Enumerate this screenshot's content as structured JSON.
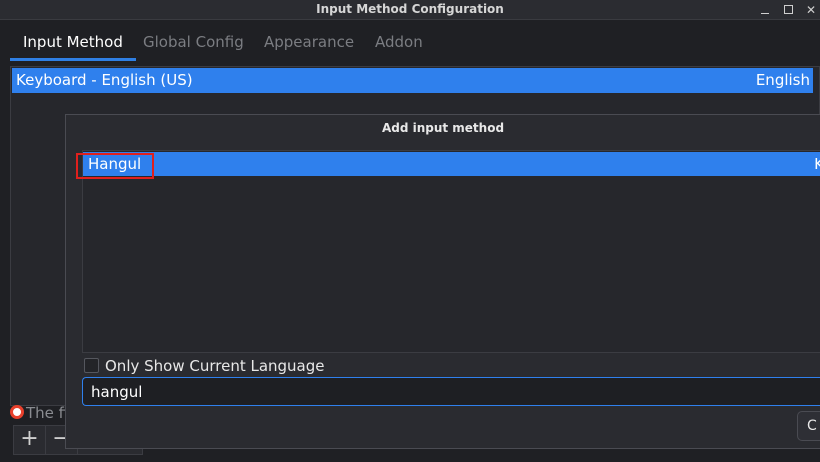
{
  "window": {
    "title": "Input Method Configuration",
    "min_icon": "minimize-icon",
    "max_icon": "maximize-icon",
    "close_icon": "close-icon",
    "close_glyph": "✕"
  },
  "tabs": [
    {
      "label": "Input Method",
      "active": true
    },
    {
      "label": "Global Config",
      "active": false
    },
    {
      "label": "Appearance",
      "active": false
    },
    {
      "label": "Addon",
      "active": false
    }
  ],
  "current_methods": [
    {
      "name": "Keyboard - English (US)",
      "language": "English"
    }
  ],
  "status": {
    "icon": "lifebuoy-icon",
    "text": "The fi"
  },
  "toolbar": {
    "add_glyph": "+",
    "remove_glyph": "−"
  },
  "dialog": {
    "title": "Add input method",
    "results": [
      {
        "name": "Hangul",
        "language": "K"
      }
    ],
    "only_current_language_label": "Only Show Current Language",
    "only_current_language_checked": false,
    "search_value": "hangul",
    "button_label": "C"
  },
  "colors": {
    "accent": "#2f80ed",
    "highlight_box": "#e0201d",
    "background": "#1f2024"
  }
}
